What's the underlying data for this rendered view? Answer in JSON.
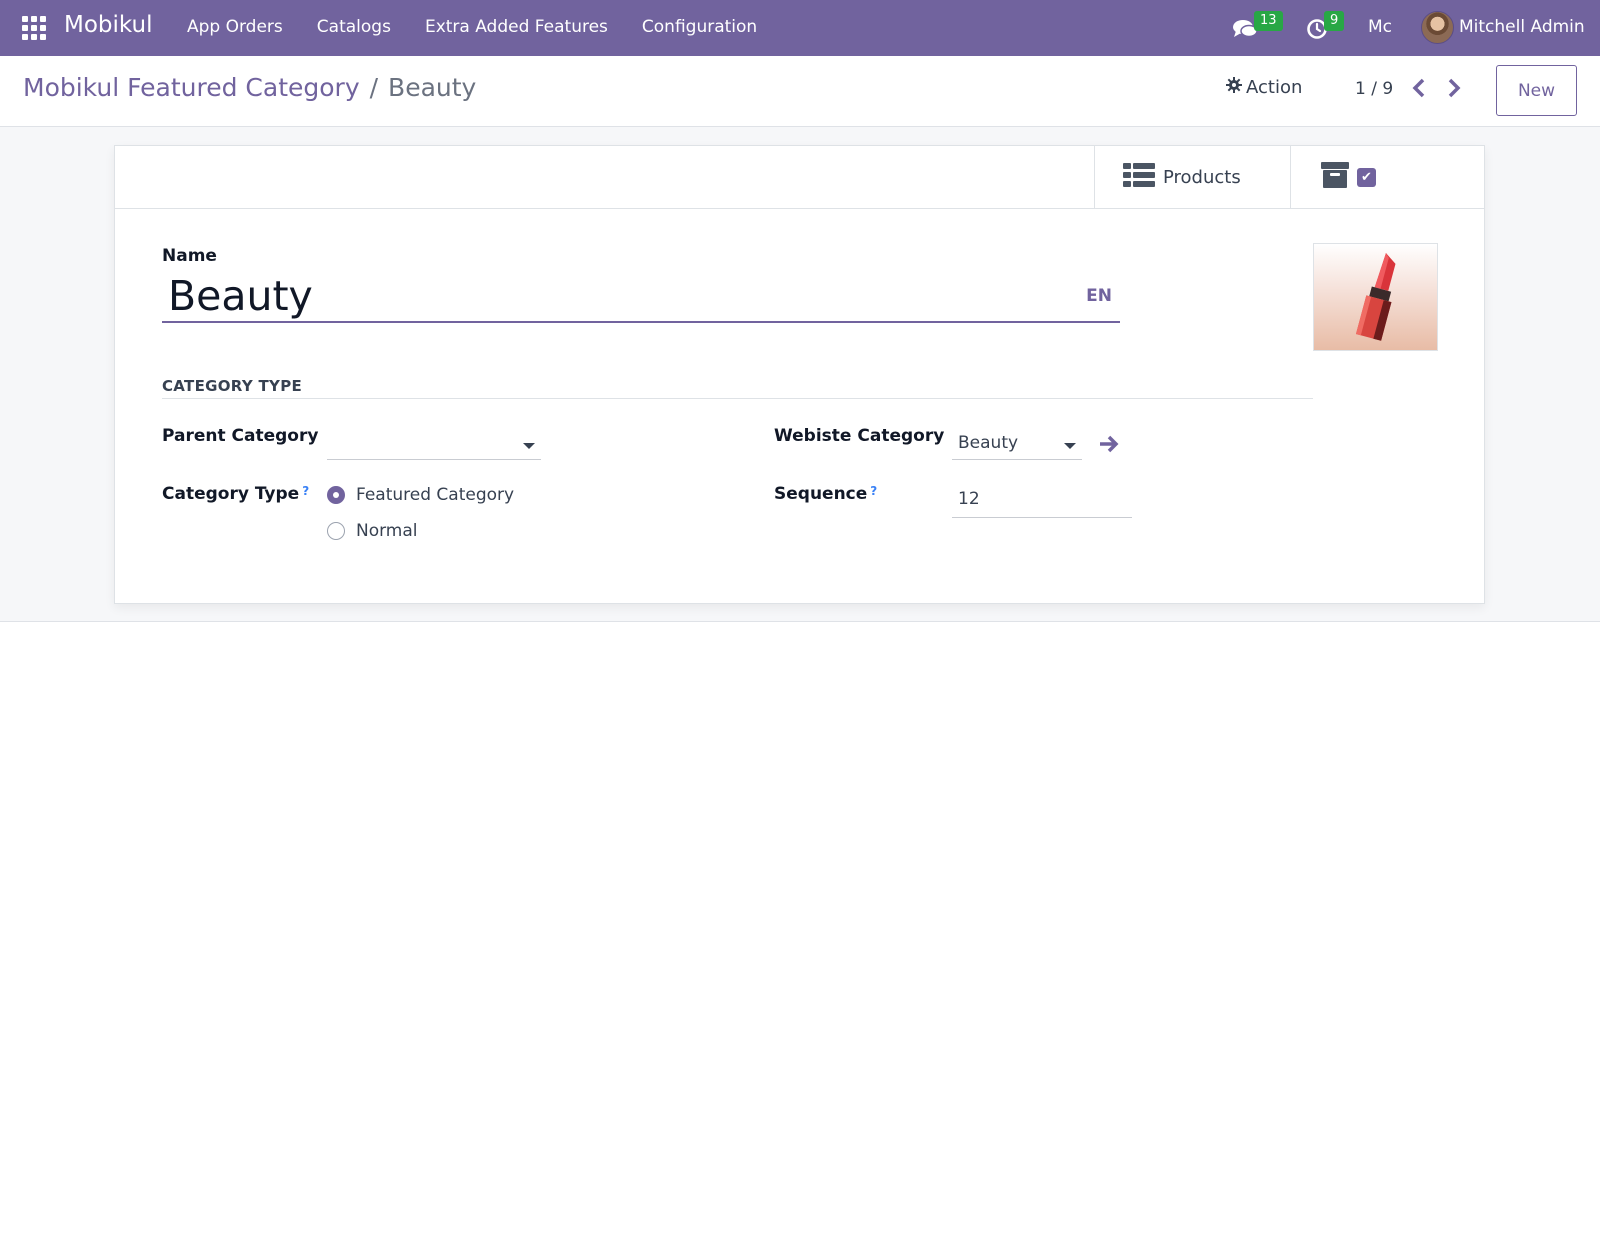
{
  "navbar": {
    "brand": "Mobikul",
    "menu": [
      "App Orders",
      "Catalogs",
      "Extra Added Features",
      "Configuration"
    ],
    "messages_count": "13",
    "activities_count": "9",
    "company": "Mc",
    "user_name": "Mitchell Admin",
    "color": "#71639e"
  },
  "control_panel": {
    "breadcrumb_parent": "Mobikul Featured Category",
    "breadcrumb_separator": "/",
    "breadcrumb_current": "Beauty",
    "action_label": "Action",
    "pager": "1 / 9",
    "new_label": "New"
  },
  "button_box": {
    "products_label": "Products",
    "archive_icon": "archive-icon",
    "archive_active": true
  },
  "form": {
    "name_label": "Name",
    "name_value": "Beauty",
    "lang": "EN",
    "section_title": "CATEGORY TYPE",
    "parent_category_label": "Parent Category",
    "parent_category_value": "",
    "website_category_label": "Webiste Category",
    "website_category_value": "Beauty",
    "category_type_label": "Category Type",
    "category_type_options": [
      "Featured Category",
      "Normal"
    ],
    "category_type_selected": "Featured Category",
    "sequence_label": "Sequence",
    "sequence_value": "12",
    "help_mark": "?",
    "image_icon": "lipstick-image"
  }
}
